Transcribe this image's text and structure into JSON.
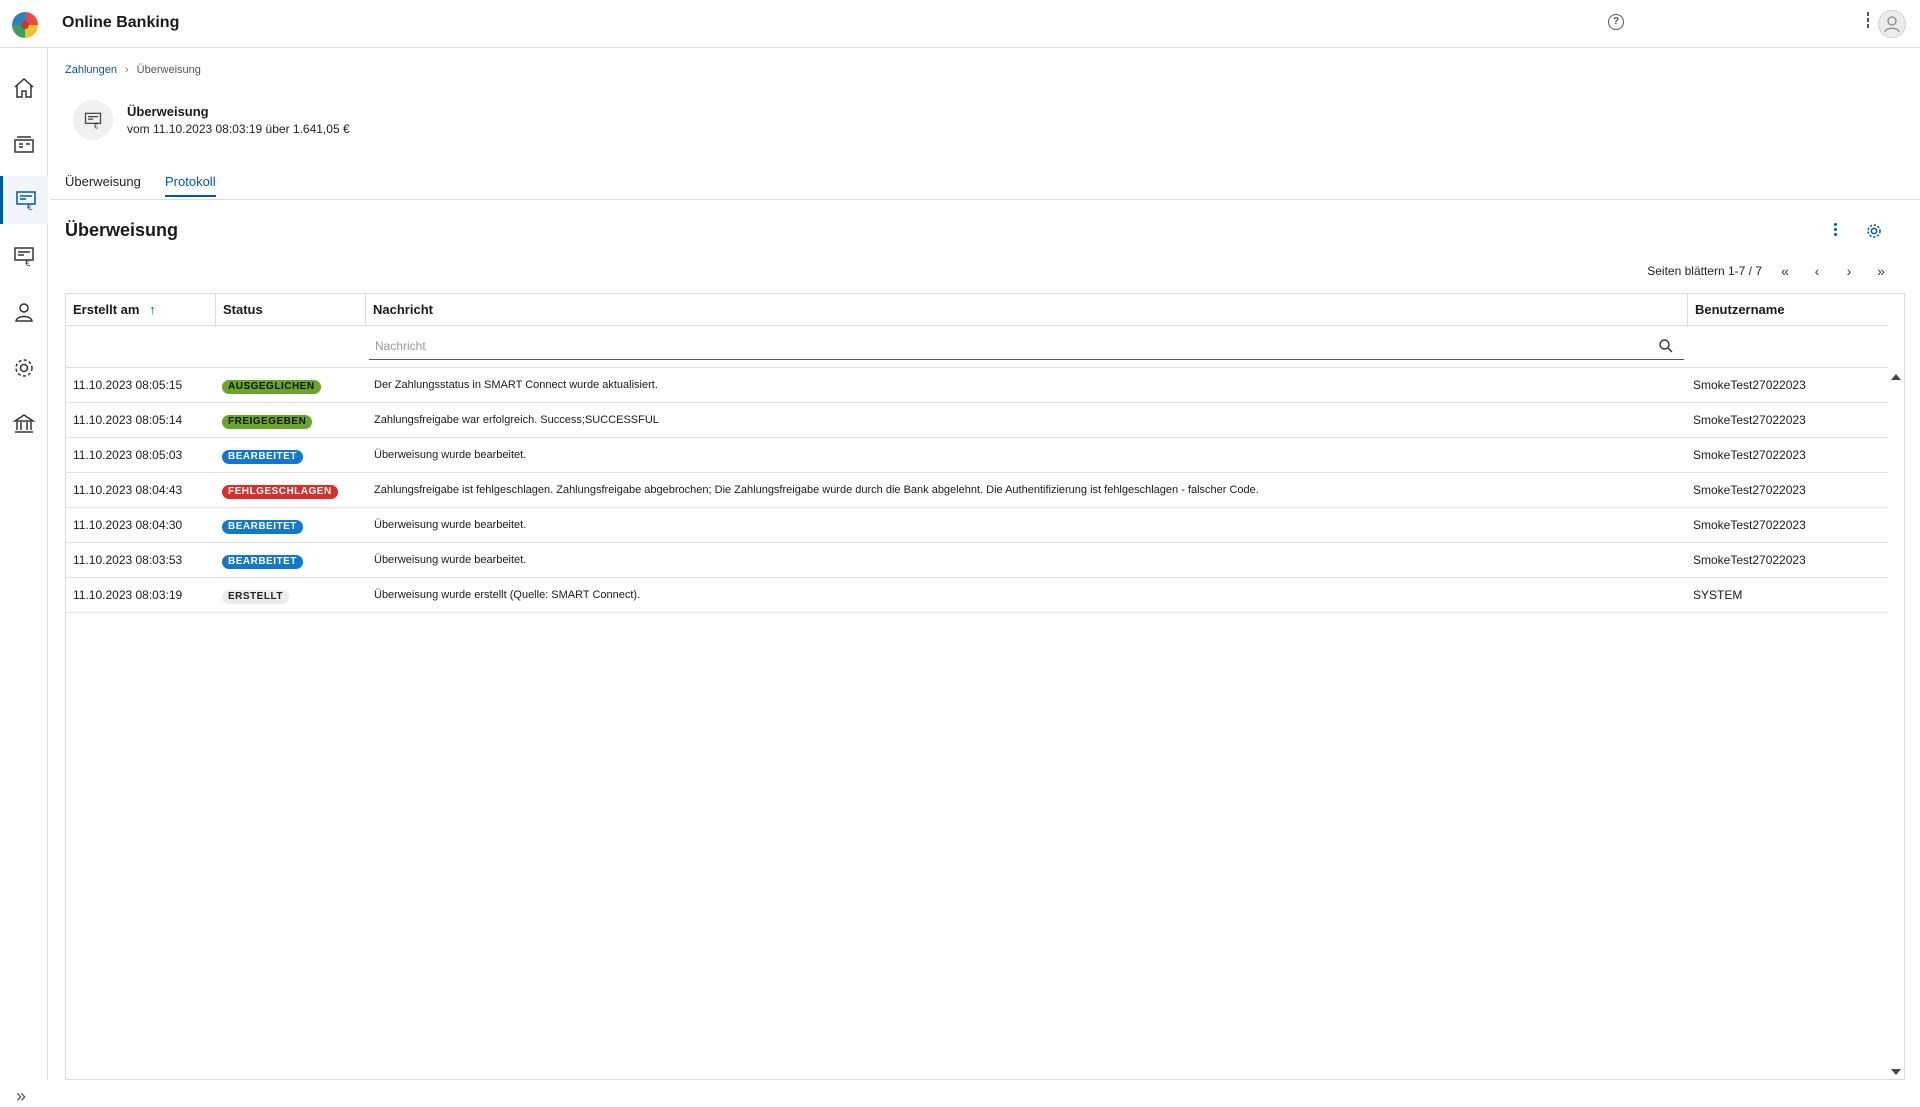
{
  "header": {
    "app_title": "Online Banking"
  },
  "breadcrumb": {
    "parent": "Zahlungen",
    "current": "Überweisung"
  },
  "document": {
    "title": "Überweisung",
    "subtitle": "vom 11.10.2023 08:03:19 über 1.641,05 €"
  },
  "tabs": [
    {
      "label": "Überweisung"
    },
    {
      "label": "Protokoll"
    }
  ],
  "section": {
    "title": "Überweisung"
  },
  "pager": {
    "text": "Seiten blättern 1-7 / 7"
  },
  "table": {
    "columns": [
      {
        "label": "Erstellt am",
        "sorted": "ascending"
      },
      {
        "label": "Status"
      },
      {
        "label": "Nachricht"
      },
      {
        "label": "Benutzername"
      }
    ],
    "filter_placeholder": "Nachricht",
    "rows": [
      {
        "date": "11.10.2023 08:05:15",
        "status": "AUSGEGLICHEN",
        "status_color": "#6ba52a",
        "message": "Der Zahlungsstatus in SMART Connect wurde aktualisiert.",
        "user": "SmokeTest27022023"
      },
      {
        "date": "11.10.2023 08:05:14",
        "status": "FREIGEGEBEN",
        "status_color": "#6ba52a",
        "message": "Zahlungsfreigabe war erfolgreich. Success;SUCCESSFUL",
        "user": "SmokeTest27022023"
      },
      {
        "date": "11.10.2023 08:05:03",
        "status": "BEARBEITET",
        "status_color": "#1179c8",
        "message": "Überweisung wurde bearbeitet.",
        "user": "SmokeTest27022023"
      },
      {
        "date": "11.10.2023 08:04:43",
        "status": "FEHLGESCHLAGEN",
        "status_color": "#d72f2f",
        "message": "Zahlungsfreigabe ist fehlgeschlagen. Zahlungsfreigabe abgebrochen; Die Zahlungsfreigabe wurde durch die Bank abgelehnt. Die Authentifizierung ist fehlgeschlagen - falscher Code.",
        "user": "SmokeTest27022023"
      },
      {
        "date": "11.10.2023 08:04:30",
        "status": "BEARBEITET",
        "status_color": "#1179c8",
        "message": "Überweisung wurde bearbeitet.",
        "user": "SmokeTest27022023"
      },
      {
        "date": "11.10.2023 08:03:53",
        "status": "BEARBEITET",
        "status_color": "#1179c8",
        "message": "Überweisung wurde bearbeitet.",
        "user": "SmokeTest27022023"
      },
      {
        "date": "11.10.2023 08:03:19",
        "status": "ERSTELLT",
        "status_color": "#ececec",
        "message": "Überweisung wurde erstellt (Quelle: SMART Connect).",
        "user": "SYSTEM"
      }
    ]
  },
  "sidenav": {
    "items": [
      {
        "icon": "home-icon"
      },
      {
        "icon": "accounts-icon"
      },
      {
        "icon": "payments-icon",
        "active": true
      },
      {
        "icon": "payment-document-icon"
      },
      {
        "icon": "user-icon"
      },
      {
        "icon": "gear-icon"
      },
      {
        "icon": "bank-icon"
      }
    ]
  },
  "colors": {
    "accent": "#005aa0"
  }
}
